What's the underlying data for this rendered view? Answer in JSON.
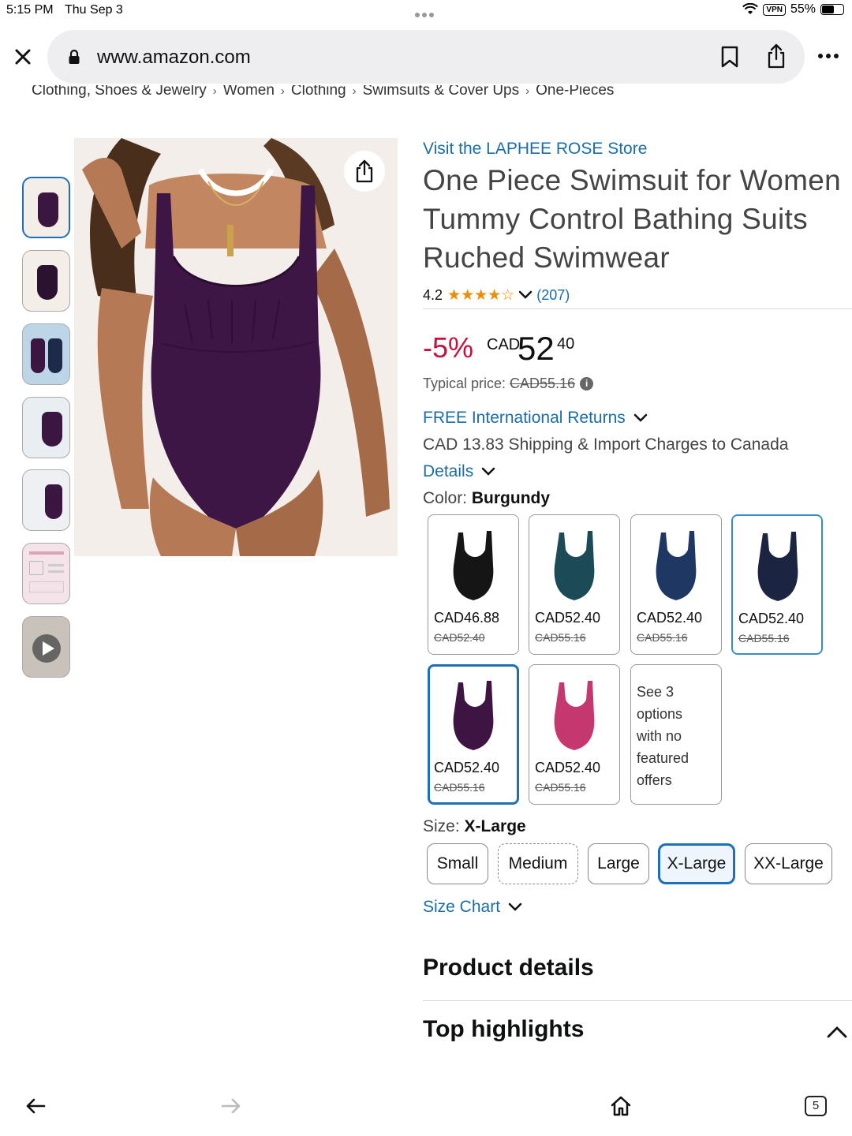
{
  "status_bar": {
    "time": "5:15 PM",
    "date": "Thu Sep 3",
    "vpn": "VPN",
    "battery": "55%",
    "battery_level": 0.55
  },
  "browser": {
    "url": "www.amazon.com",
    "tab_count": "5"
  },
  "breadcrumb": [
    "Clothing, Shoes & Jewelry",
    "Women",
    "Clothing",
    "Swimsuits & Cover Ups",
    "One-Pieces"
  ],
  "breadcrumb_separator": "›",
  "product": {
    "store_link": "Visit the LAPHEE ROSE Store",
    "title_lines": [
      "One Piece Swimsuit for Women",
      "Tummy Control Bathing Suits",
      "Ruched Swimwear"
    ],
    "rating": "4.2",
    "stars": "★★★★☆",
    "review_count": "(207)",
    "discount": "-5%",
    "price_currency": "CAD",
    "price_whole": "52",
    "price_fraction": "40",
    "typical_label": "Typical price:",
    "typical_price": "CAD55.16",
    "returns": "FREE International Returns",
    "shipping": "CAD 13.83 Shipping & Import Charges to Canada",
    "details": "Details",
    "color_label": "Color:",
    "color_value": "Burgundy",
    "size_label": "Size:",
    "size_value": "X-Large",
    "size_chart": "Size Chart"
  },
  "colors": [
    {
      "price": "CAD46.88",
      "old": "CAD52.40",
      "swatch": "#151515"
    },
    {
      "price": "CAD52.40",
      "old": "CAD55.16",
      "swatch": "#1c4b57"
    },
    {
      "price": "CAD52.40",
      "old": "CAD55.16",
      "swatch": "#1e3763"
    },
    {
      "price": "CAD52.40",
      "old": "CAD55.16",
      "swatch": "#1b2440"
    },
    {
      "price": "CAD52.40",
      "old": "CAD55.16",
      "swatch": "#3d1442"
    },
    {
      "price": "CAD52.40",
      "old": "CAD55.16",
      "swatch": "#c4386f"
    }
  ],
  "more_options": [
    "See 3",
    "options",
    "with no",
    "featured",
    "offers"
  ],
  "sizes": [
    "Small",
    "Medium",
    "Large",
    "X-Large",
    "XX-Large"
  ],
  "sections": {
    "product_details": "Product details",
    "top_highlights": "Top highlights"
  },
  "colors_theme": {
    "link": "#1a6ca8",
    "deal": "#cc0c39",
    "selected_border": "#1e6fb8",
    "star": "#f08c00",
    "swimsuit": "#3a1640"
  }
}
